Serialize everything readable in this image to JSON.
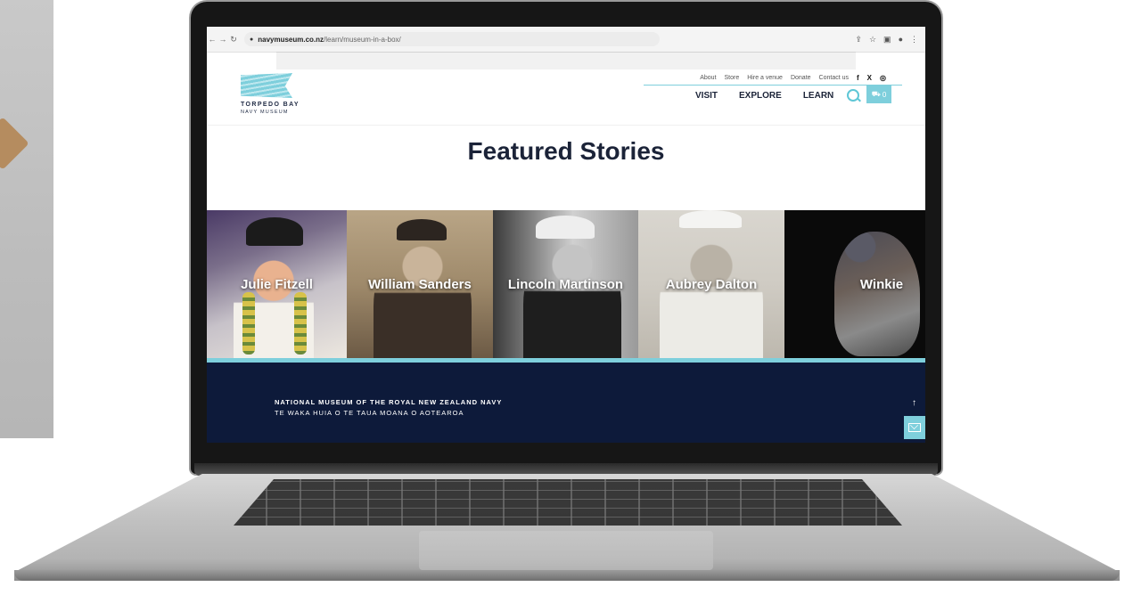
{
  "browser": {
    "url_host": "navymuseum.co.nz",
    "url_path": "/learn/museum-in-a-box/"
  },
  "logo": {
    "line1": "TORPEDO BAY",
    "line2": "NAVY MUSEUM"
  },
  "top_links": [
    "About",
    "Store",
    "Hire a venue",
    "Donate",
    "Contact us"
  ],
  "social": {
    "facebook": "f",
    "x": "X",
    "instagram": "◎"
  },
  "main_nav": [
    "VISIT",
    "EXPLORE",
    "LEARN"
  ],
  "cart": {
    "count": "0"
  },
  "page_title": "Featured Stories",
  "stories": [
    {
      "name": "Julie Fitzell"
    },
    {
      "name": "William Sanders"
    },
    {
      "name": "Lincoln Martinson"
    },
    {
      "name": "Aubrey Dalton"
    },
    {
      "name": "Winkie"
    }
  ],
  "footer": {
    "line1": "NATIONAL MUSEUM OF THE ROYAL NEW ZEALAND NAVY",
    "line2": "TE WAKA HUIA O TE TAUA MOANA O AOTEAROA"
  },
  "colors": {
    "accent": "#7ecfdc",
    "navy": "#0d1a3a",
    "title": "#1b2338"
  },
  "icons": [
    "back-icon",
    "forward-icon",
    "reload-icon",
    "lock-icon",
    "share-icon",
    "star-icon",
    "sidebar-icon",
    "profile-icon",
    "menu-icon",
    "search-icon",
    "cart-icon",
    "scroll-top-icon",
    "mail-icon"
  ]
}
